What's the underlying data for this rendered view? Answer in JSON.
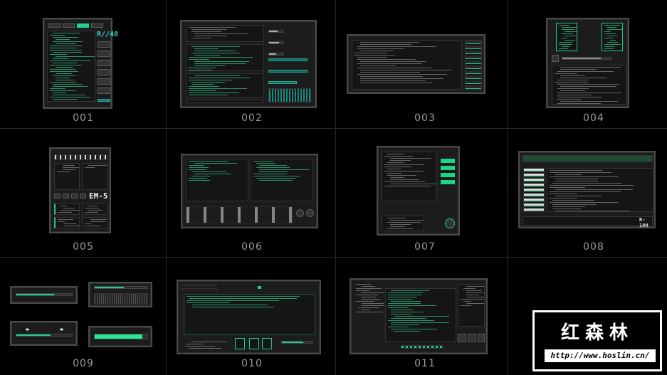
{
  "thumbnails": [
    {
      "label": "001",
      "readout": "R//48"
    },
    {
      "label": "002"
    },
    {
      "label": "003"
    },
    {
      "label": "004"
    },
    {
      "label": "005",
      "readout": "EM-5"
    },
    {
      "label": "006"
    },
    {
      "label": "007"
    },
    {
      "label": "008",
      "readout": "R-18H"
    },
    {
      "label": "009",
      "progress": [
        0.68,
        0.55,
        0.62,
        0.9
      ]
    },
    {
      "label": "010"
    },
    {
      "label": "011"
    }
  ],
  "watermark": {
    "title": "红森林",
    "url": "http://www.hoslin.cn/"
  },
  "colors": {
    "accent": "#1ed48a",
    "code": "#2fa878",
    "panel": "#1c1c1c",
    "border": "#4a4a4a"
  }
}
